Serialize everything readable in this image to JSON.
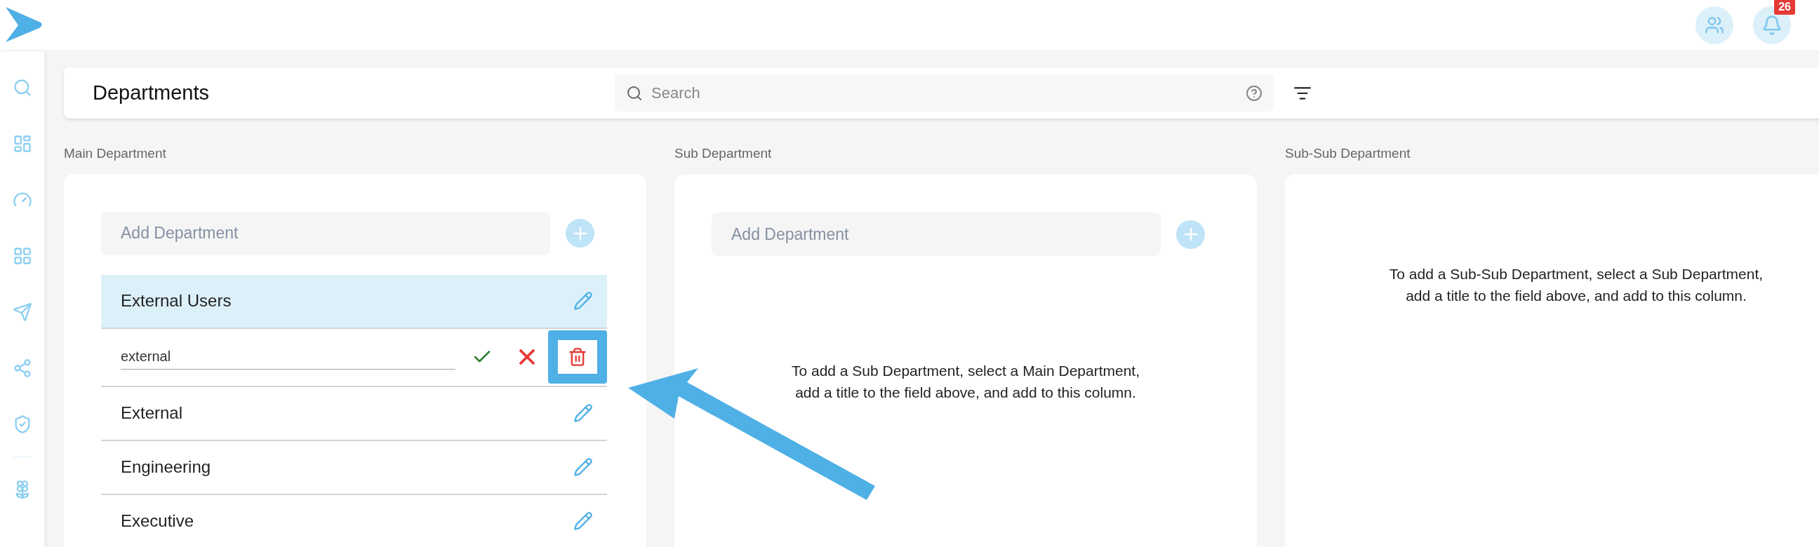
{
  "page": {
    "title": "Departments"
  },
  "search": {
    "placeholder": "Search"
  },
  "notifications": {
    "count": "26"
  },
  "columns": [
    {
      "label": "Main Department",
      "add_placeholder": "Add Department",
      "items": [
        {
          "kind": "item",
          "name": "External Users",
          "selected": true
        },
        {
          "kind": "editing",
          "value": "external"
        },
        {
          "kind": "item",
          "name": "External",
          "selected": false
        },
        {
          "kind": "item",
          "name": "Engineering",
          "selected": false
        },
        {
          "kind": "item",
          "name": "Executive",
          "selected": false
        }
      ]
    },
    {
      "label": "Sub Department",
      "add_placeholder": "Add Department",
      "hint": "To add a Sub Department, select a Main Department, add a title to the field above, and add to this column."
    },
    {
      "label": "Sub-Sub Department",
      "hint": "To add a Sub-Sub Department, select a Sub Department, add a title to the field above, and add to this column."
    }
  ]
}
